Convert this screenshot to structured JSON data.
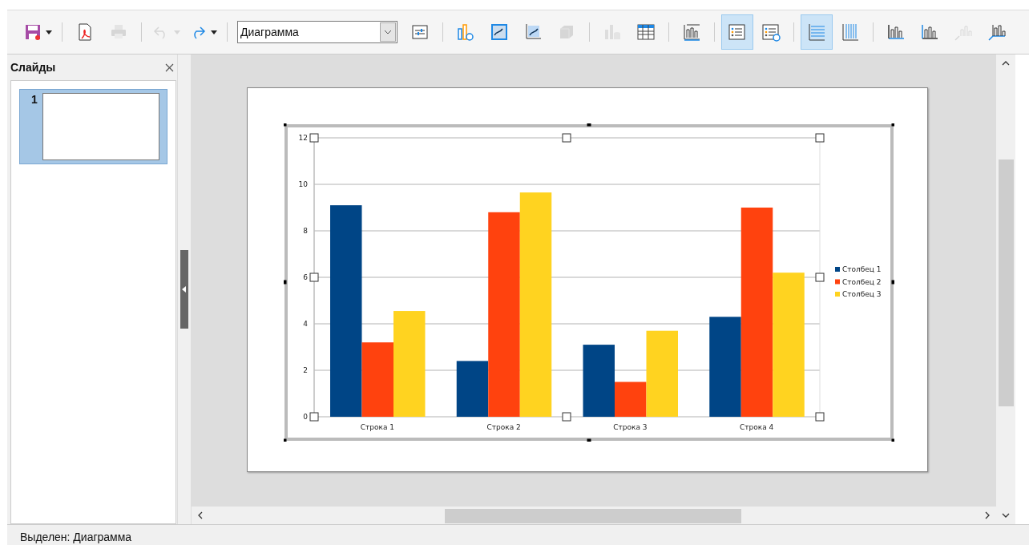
{
  "toolbar": {
    "groups": [
      [
        {
          "kind": "save",
          "dropdown": true,
          "disabled": false,
          "selected": false
        }
      ],
      [
        {
          "kind": "pdf",
          "dropdown": false,
          "disabled": false,
          "selected": false
        },
        {
          "kind": "print",
          "dropdown": false,
          "disabled": true,
          "selected": false
        }
      ],
      [
        {
          "kind": "undo",
          "dropdown": true,
          "disabled": true,
          "selected": false
        },
        {
          "kind": "redo",
          "dropdown": true,
          "disabled": false,
          "selected": false
        }
      ],
      [
        {
          "kind": "combo",
          "value": "Диаграмма"
        },
        {
          "kind": "properties",
          "dropdown": false,
          "disabled": false,
          "selected": false
        }
      ],
      [
        {
          "kind": "charttype",
          "dropdown": false,
          "disabled": false,
          "selected": false
        },
        {
          "kind": "wall",
          "dropdown": false,
          "disabled": false,
          "selected": false
        },
        {
          "kind": "area",
          "dropdown": false,
          "disabled": false,
          "selected": false
        },
        {
          "kind": "threed",
          "dropdown": false,
          "disabled": true,
          "selected": false
        }
      ],
      [
        {
          "kind": "ranges",
          "dropdown": false,
          "disabled": true,
          "selected": false
        },
        {
          "kind": "table",
          "dropdown": false,
          "disabled": false,
          "selected": false
        }
      ],
      [
        {
          "kind": "titles",
          "dropdown": false,
          "disabled": false,
          "selected": false
        }
      ],
      [
        {
          "kind": "legend",
          "dropdown": false,
          "disabled": false,
          "selected": true
        },
        {
          "kind": "legendformat",
          "dropdown": false,
          "disabled": false,
          "selected": false
        }
      ],
      [
        {
          "kind": "hgrid",
          "dropdown": false,
          "disabled": false,
          "selected": true
        },
        {
          "kind": "vgrid",
          "dropdown": false,
          "disabled": false,
          "selected": false
        }
      ],
      [
        {
          "kind": "xaxis",
          "dropdown": false,
          "disabled": false,
          "selected": false
        },
        {
          "kind": "yaxis",
          "dropdown": false,
          "disabled": false,
          "selected": false
        },
        {
          "kind": "zaxis",
          "dropdown": false,
          "disabled": true,
          "selected": false
        },
        {
          "kind": "axes",
          "dropdown": false,
          "disabled": false,
          "selected": false
        }
      ]
    ]
  },
  "slides_panel": {
    "title": "Слайды",
    "slides": [
      {
        "number": "1",
        "selected": true
      }
    ]
  },
  "canvas": {
    "chart": {
      "chart_data": {
        "type": "bar",
        "categories": [
          "Строка 1",
          "Строка 2",
          "Строка 3",
          "Строка 4"
        ],
        "series": [
          {
            "name": "Столбец 1",
            "color": "#004586",
            "values": [
              9.1,
              2.4,
              3.1,
              4.3
            ]
          },
          {
            "name": "Столбец 2",
            "color": "#ff420e",
            "values": [
              3.2,
              8.8,
              1.5,
              9.0
            ]
          },
          {
            "name": "Столбец 3",
            "color": "#ffd320",
            "values": [
              4.55,
              9.65,
              3.7,
              6.2
            ]
          }
        ],
        "ylim": [
          0,
          12
        ],
        "yticks": [
          0,
          2,
          4,
          6,
          8,
          10,
          12
        ],
        "grid": true,
        "legend": true
      }
    }
  },
  "status_bar": {
    "text": "Выделен: Диаграмма"
  }
}
